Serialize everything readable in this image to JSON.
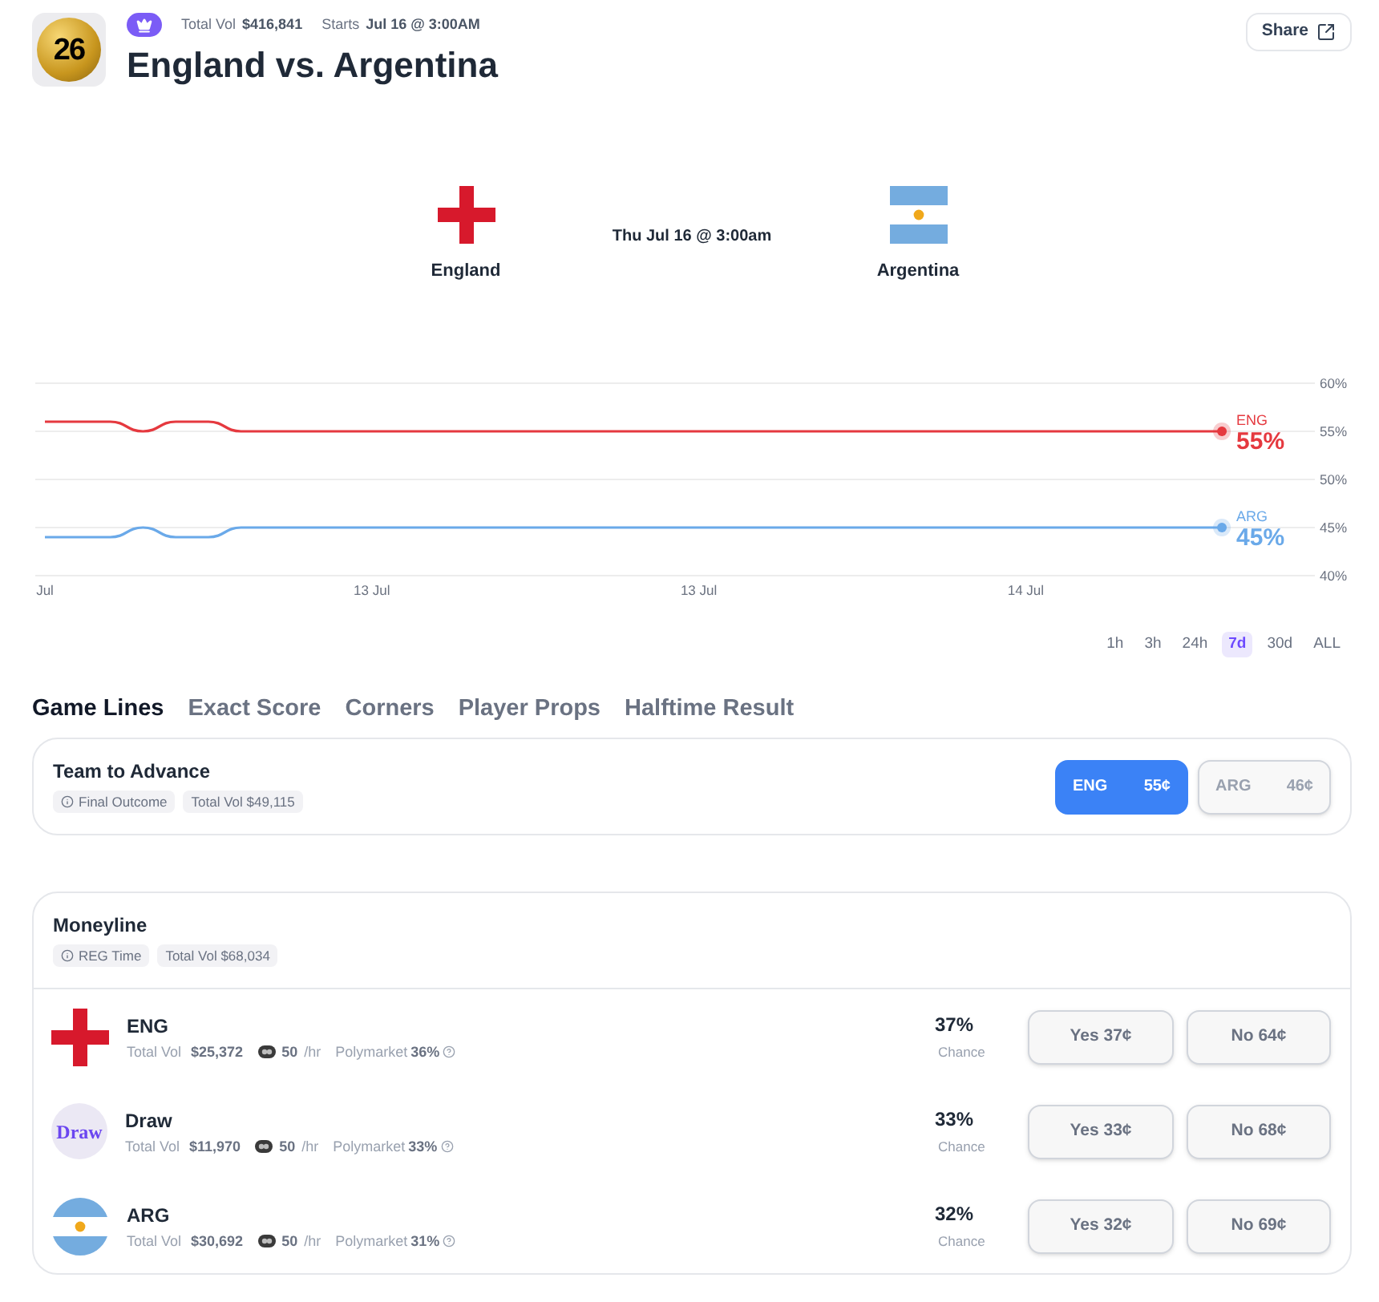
{
  "header": {
    "logo_text": "26",
    "stats": [
      {
        "label": "Total Vol",
        "value": "$416,841"
      },
      {
        "label": "Starts",
        "value": "Jul 16 @ 3:00AM"
      }
    ],
    "title": "England vs. Argentina",
    "share": "Share"
  },
  "matchup": {
    "teams": [
      {
        "kind": "england",
        "name": "England"
      },
      {
        "kind": "argentina",
        "name": "Argentina"
      }
    ],
    "time": "Thu Jul 16 @ 3:00am"
  },
  "chart": {
    "chart_data": {
      "type": "line",
      "grid": true,
      "categories": [
        "Jul",
        null,
        null,
        null,
        null,
        null,
        null,
        null,
        null,
        null,
        "13 Jul",
        null,
        null,
        null,
        null,
        null,
        null,
        null,
        null,
        null,
        "13 Jul",
        null,
        null,
        null,
        null,
        null,
        null,
        null,
        null,
        null,
        "14 Jul",
        null,
        null,
        null,
        null,
        null,
        null,
        null,
        null,
        null
      ],
      "series": [
        {
          "name": "ENG",
          "color": "#e5393f",
          "values": [
            56,
            56,
            56,
            55,
            56,
            56,
            55,
            55,
            55,
            55,
            55,
            55,
            55,
            55,
            55,
            55,
            55,
            55,
            55,
            55,
            55,
            55,
            55,
            55,
            55,
            55,
            55,
            55,
            55,
            55,
            55,
            55,
            55,
            55,
            55,
            55,
            55,
            null,
            null,
            null
          ]
        },
        {
          "name": "ARG",
          "color": "#6aa9e9",
          "values": [
            44,
            44,
            44,
            45,
            44,
            44,
            45,
            45,
            45,
            45,
            45,
            45,
            45,
            45,
            45,
            45,
            45,
            45,
            45,
            45,
            45,
            45,
            45,
            45,
            45,
            45,
            45,
            45,
            45,
            45,
            45,
            45,
            45,
            45,
            45,
            45,
            45,
            null,
            null,
            null
          ]
        }
      ],
      "ylim": [
        40,
        60
      ],
      "yticks": [
        {
          "value": 40,
          "label": "40%"
        },
        {
          "value": 45,
          "label": "45%"
        },
        {
          "value": 50,
          "label": "50%"
        },
        {
          "value": 55,
          "label": "55%"
        },
        {
          "value": 60,
          "label": "60%"
        }
      ]
    },
    "end_values": [
      "55%",
      "45%"
    ],
    "ranges": [
      {
        "label": "1h",
        "selected": false
      },
      {
        "label": "3h",
        "selected": false
      },
      {
        "label": "24h",
        "selected": false
      },
      {
        "label": "7d",
        "selected": true
      },
      {
        "label": "30d",
        "selected": false
      },
      {
        "label": "ALL",
        "selected": false
      }
    ]
  },
  "tabs": [
    {
      "label": "Game Lines",
      "selected": true
    },
    {
      "label": "Exact Score",
      "selected": false
    },
    {
      "label": "Corners",
      "selected": false
    },
    {
      "label": "Player Props",
      "selected": false
    },
    {
      "label": "Halftime Result",
      "selected": false
    }
  ],
  "team_to_advance": {
    "title": "Team to Advance",
    "tags": [
      {
        "kind": "info",
        "text": "Final Outcome"
      },
      {
        "kind": "plain",
        "text": "Total Vol $49,115"
      }
    ],
    "options": [
      {
        "label": "ENG",
        "price": "55¢",
        "selected": true
      },
      {
        "label": "ARG",
        "price": "46¢",
        "selected": false
      }
    ]
  },
  "moneyline": {
    "title": "Moneyline",
    "tags": [
      {
        "kind": "info",
        "text": "REG Time"
      },
      {
        "kind": "plain",
        "text": "Total Vol $68,034"
      }
    ],
    "rows": [
      {
        "kind": "england",
        "name": "ENG",
        "vol_label": "Total Vol",
        "vol": "$25,372",
        "rate": "50",
        "rate_unit": "/hr",
        "source": "Polymarket",
        "source_pct": "36%",
        "chance": "37%",
        "chance_label": "Chance",
        "yes": "Yes 37¢",
        "no": "No 64¢"
      },
      {
        "kind": "draw",
        "logo_text": "Draw",
        "name": "Draw",
        "vol_label": "Total Vol",
        "vol": "$11,970",
        "rate": "50",
        "rate_unit": "/hr",
        "source": "Polymarket",
        "source_pct": "33%",
        "chance": "33%",
        "chance_label": "Chance",
        "yes": "Yes 33¢",
        "no": "No 68¢"
      },
      {
        "kind": "argentina",
        "name": "ARG",
        "vol_label": "Total Vol",
        "vol": "$30,692",
        "rate": "50",
        "rate_unit": "/hr",
        "source": "Polymarket",
        "source_pct": "31%",
        "chance": "32%",
        "chance_label": "Chance",
        "yes": "Yes 32¢",
        "no": "No 69¢"
      }
    ]
  }
}
